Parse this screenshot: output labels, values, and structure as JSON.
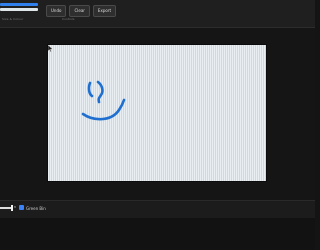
{
  "toolbar": {
    "colors": [
      "#2f80ed",
      "#dfe6ea"
    ],
    "left_label": "Size & Colour",
    "buttons": [
      "Undo",
      "Clear",
      "Export"
    ],
    "mid_label": "Controls"
  },
  "bottombar": {
    "slider_value": "8",
    "checkbox_label": "Green Bin",
    "checked": true
  }
}
